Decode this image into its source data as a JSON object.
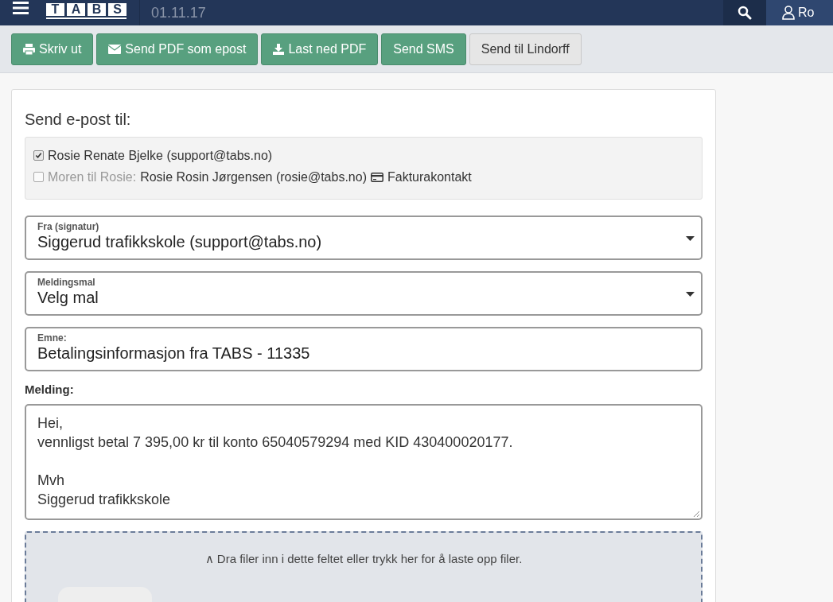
{
  "header": {
    "logo": [
      "T",
      "A",
      "B",
      "S"
    ],
    "date": "01.11.17",
    "user": "Ro"
  },
  "toolbar": [
    {
      "label": "Skriv ut",
      "kind": "primary"
    },
    {
      "label": "Send PDF som epost",
      "kind": "primary"
    },
    {
      "label": "Last ned PDF",
      "kind": "primary"
    },
    {
      "label": "Send SMS",
      "kind": "primary"
    },
    {
      "label": "Send til Lindorff",
      "kind": "default"
    }
  ],
  "email": {
    "heading": "Send e-post til:",
    "recipients": [
      {
        "name": "Rosie Renate Bjelke (support@tabs.no)",
        "checked": true
      },
      {
        "relation": "Moren til Rosie:",
        "name": "Rosie Rosin Jørgensen (rosie@tabs.no)",
        "tag": "Fakturakontakt",
        "checked": false
      }
    ],
    "fields": [
      {
        "kind": "select",
        "label": "Fra (signatur)",
        "value": "Siggerud trafikkskole (support@tabs.no)"
      },
      {
        "kind": "select",
        "label": "Meldingsmal",
        "value": "Velg mal"
      },
      {
        "kind": "text",
        "label": "Emne:",
        "value": "Betalingsinformasjon fra TABS - 11335"
      }
    ],
    "message_label": "Melding:",
    "message": "Hei,\nvennligst betal 7 395,00 kr til konto 65040579294 med KID 430400020177.\n\nMvh\nSiggerud trafikkskole",
    "dropzone": {
      "arrow": "∧",
      "text": "Dra filer inn i dette feltet eller trykk her for å laste opp filer."
    }
  }
}
